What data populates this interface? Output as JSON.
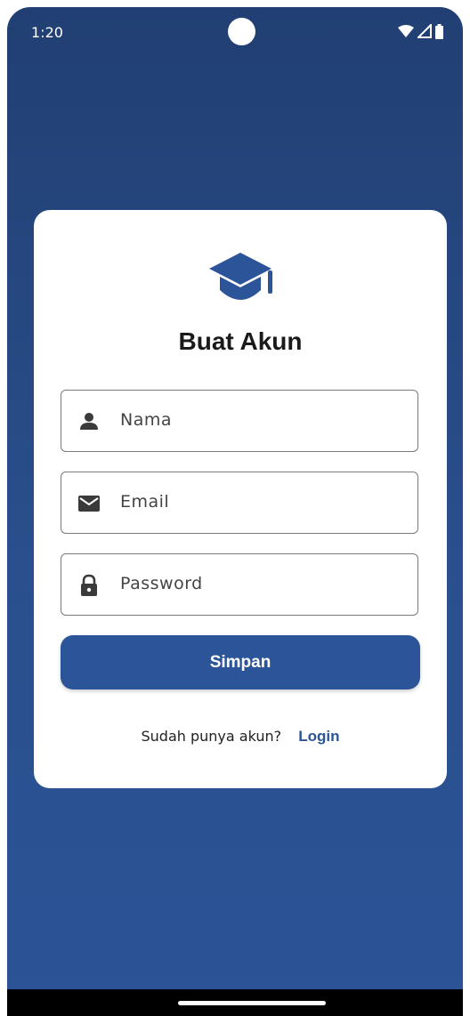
{
  "status_bar": {
    "time": "1:20",
    "icons": [
      "wifi-icon",
      "cellular-signal-icon",
      "battery-icon"
    ]
  },
  "logo": {
    "icon": "graduation-cap-icon",
    "color": "#2c5599"
  },
  "form": {
    "title": "Buat Akun",
    "fields": [
      {
        "icon": "person-icon",
        "placeholder": "Nama"
      },
      {
        "icon": "mail-icon",
        "placeholder": "Email"
      },
      {
        "icon": "lock-icon",
        "placeholder": "Password"
      }
    ],
    "submit_label": "Simpan",
    "login_prompt": "Sudah punya akun?",
    "login_link": "Login"
  },
  "colors": {
    "accent": "#2c5599",
    "background_top": "#213f73",
    "background_bottom": "#2b5396"
  }
}
